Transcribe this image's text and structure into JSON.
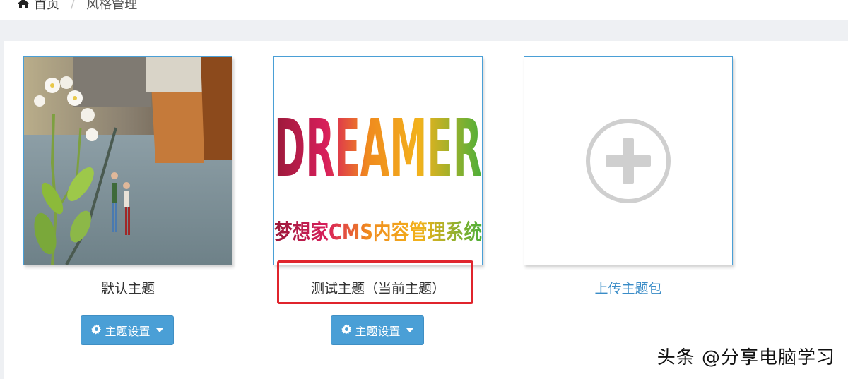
{
  "breadcrumb": {
    "home_label": "首页",
    "separator": "/",
    "current_label": "风格管理"
  },
  "themes": [
    {
      "name": "默认主题",
      "button_label": "主题设置"
    },
    {
      "name": "测试主题（当前主题）",
      "button_label": "主题设置",
      "logo_text": "DREAMER",
      "logo_subtitle": "梦想家CMS内容管理系统"
    },
    {
      "name": "上传主题包"
    }
  ],
  "watermark": "头条 @分享电脑学习",
  "colors": {
    "accent": "#4a9fd6",
    "link": "#3a8cc7",
    "highlight": "#e0242c"
  },
  "icons": [
    "home-icon",
    "gear-icon",
    "caret-down-icon",
    "plus-circle-icon"
  ]
}
